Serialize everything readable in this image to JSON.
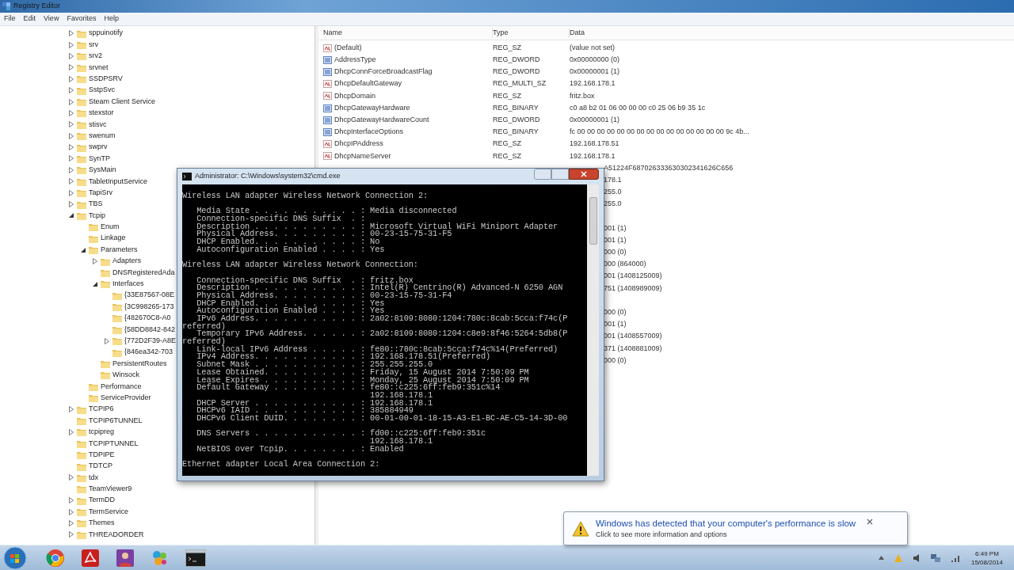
{
  "window": {
    "title": "Registry Editor"
  },
  "menu": [
    "File",
    "Edit",
    "View",
    "Favorites",
    "Help"
  ],
  "tree": [
    {
      "label": "sppuinotify",
      "expanded": false
    },
    {
      "label": "srv",
      "expanded": false
    },
    {
      "label": "srv2",
      "expanded": false
    },
    {
      "label": "srvnet",
      "expanded": false
    },
    {
      "label": "SSDPSRV",
      "expanded": false
    },
    {
      "label": "SstpSvc",
      "expanded": false
    },
    {
      "label": "Steam Client Service",
      "expanded": false
    },
    {
      "label": "stexstor",
      "expanded": false
    },
    {
      "label": "stisvc",
      "expanded": false
    },
    {
      "label": "swenum",
      "expanded": false
    },
    {
      "label": "swprv",
      "expanded": false
    },
    {
      "label": "SynTP",
      "expanded": false
    },
    {
      "label": "SysMain",
      "expanded": false
    },
    {
      "label": "TabletInputService",
      "expanded": false
    },
    {
      "label": "TapiSrv",
      "expanded": false
    },
    {
      "label": "TBS",
      "expanded": false
    },
    {
      "label": "Tcpip",
      "expanded": true,
      "children": [
        {
          "label": "Enum"
        },
        {
          "label": "Linkage"
        },
        {
          "label": "Parameters",
          "expanded": true,
          "children": [
            {
              "label": "Adapters",
              "expanded": false
            },
            {
              "label": "DNSRegisteredAda"
            },
            {
              "label": "Interfaces",
              "expanded": true,
              "children": [
                {
                  "label": "{33E87567-08E"
                },
                {
                  "label": "{3C998265-173"
                },
                {
                  "label": "{482670C8-A0"
                },
                {
                  "label": "{58DD8842-842"
                },
                {
                  "label": "{772D2F39-A8E",
                  "expanded": false
                },
                {
                  "label": "{846ea342-703"
                }
              ]
            },
            {
              "label": "PersistentRoutes"
            },
            {
              "label": "Winsock"
            }
          ]
        },
        {
          "label": "Performance"
        },
        {
          "label": "ServiceProvider"
        }
      ]
    },
    {
      "label": "TCPIP6",
      "expanded": false
    },
    {
      "label": "TCPIP6TUNNEL"
    },
    {
      "label": "tcpipreg",
      "expanded": false
    },
    {
      "label": "TCPIPTUNNEL"
    },
    {
      "label": "TDPIPE"
    },
    {
      "label": "TDTCP"
    },
    {
      "label": "tdx",
      "expanded": false
    },
    {
      "label": "TeamViewer9"
    },
    {
      "label": "TermDD",
      "expanded": false
    },
    {
      "label": "TermService",
      "expanded": false
    },
    {
      "label": "Themes",
      "expanded": false
    },
    {
      "label": "THREADORDER",
      "expanded": false
    }
  ],
  "values": {
    "columns": [
      "Name",
      "Type",
      "Data"
    ],
    "rows": [
      {
        "kind": "string",
        "name": "(Default)",
        "type": "REG_SZ",
        "data": "(value not set)"
      },
      {
        "kind": "number",
        "name": "AddressType",
        "type": "REG_DWORD",
        "data": "0x00000000 (0)"
      },
      {
        "kind": "number",
        "name": "DhcpConnForceBroadcastFlag",
        "type": "REG_DWORD",
        "data": "0x00000001 (1)"
      },
      {
        "kind": "string",
        "name": "DhcpDefaultGateway",
        "type": "REG_MULTI_SZ",
        "data": "192.168.178.1"
      },
      {
        "kind": "string",
        "name": "DhcpDomain",
        "type": "REG_SZ",
        "data": "fritz.box"
      },
      {
        "kind": "number",
        "name": "DhcpGatewayHardware",
        "type": "REG_BINARY",
        "data": "c0 a8 b2 01 06 00 00 00 c0 25 06 b9 35 1c"
      },
      {
        "kind": "number",
        "name": "DhcpGatewayHardwareCount",
        "type": "REG_DWORD",
        "data": "0x00000001 (1)"
      },
      {
        "kind": "number",
        "name": "DhcpInterfaceOptions",
        "type": "REG_BINARY",
        "data": "fc 00 00 00 00 00 00 00 00 00 00 00 00 00 00 00 9c 4b..."
      },
      {
        "kind": "string",
        "name": "DhcpIPAddress",
        "type": "REG_SZ",
        "data": "192.168.178.51"
      },
      {
        "kind": "string",
        "name": "DhcpNameServer",
        "type": "REG_SZ",
        "data": "192.168.178.1"
      },
      {
        "kind": "covered",
        "data": "A51224F687026333630302341626C656"
      },
      {
        "kind": "covered",
        "data": "178.1"
      },
      {
        "kind": "covered",
        "data": "255.0"
      },
      {
        "kind": "covered",
        "data": "255.0"
      },
      {
        "kind": "hidden"
      },
      {
        "kind": "covered",
        "data": "001 (1)"
      },
      {
        "kind": "covered",
        "data": "001 (1)"
      },
      {
        "kind": "covered",
        "data": "000 (0)"
      },
      {
        "kind": "covered",
        "data": "000 (864000)"
      },
      {
        "kind": "covered",
        "data": "001 (1408125009)"
      },
      {
        "kind": "covered",
        "data": "751 (1408989009)"
      },
      {
        "kind": "hidden"
      },
      {
        "kind": "covered",
        "data": "000 (0)"
      },
      {
        "kind": "covered",
        "data": "001 (1)"
      },
      {
        "kind": "covered",
        "data": "001 (1408557009)"
      },
      {
        "kind": "covered",
        "data": "371 (1408881009)"
      },
      {
        "kind": "covered",
        "data": "000 (0)"
      }
    ]
  },
  "console": {
    "title": "Administrator: C:\\Windows\\system32\\cmd.exe",
    "lines": [
      {
        "kind": "text",
        "text": "Wireless LAN adapter Wireless Network Connection 2:"
      },
      {
        "kind": "blank"
      },
      {
        "kind": "text",
        "text": "   Media State . . . . . . . . . . . : Media disconnected"
      },
      {
        "kind": "text",
        "text": "   Connection-specific DNS Suffix  . :"
      },
      {
        "kind": "text",
        "text": "   Description . . . . . . . . . . . : Microsoft Virtual WiFi Miniport Adapter"
      },
      {
        "kind": "text",
        "text": "   Physical Address. . . . . . . . . : 00-23-15-75-31-F5"
      },
      {
        "kind": "text",
        "text": "   DHCP Enabled. . . . . . . . . . . : No"
      },
      {
        "kind": "text",
        "text": "   Autoconfiguration Enabled . . . . : Yes"
      },
      {
        "kind": "blank"
      },
      {
        "kind": "text",
        "text": "Wireless LAN adapter Wireless Network Connection:"
      },
      {
        "kind": "blank"
      },
      {
        "kind": "text",
        "text": "   Connection-specific DNS Suffix  . : fritz.box"
      },
      {
        "kind": "text",
        "text": "   Description . . . . . . . . . . . : Intel(R) Centrino(R) Advanced-N 6250 AGN"
      },
      {
        "kind": "text",
        "text": "   Physical Address. . . . . . . . . : 00-23-15-75-31-F4"
      },
      {
        "kind": "text",
        "text": "   DHCP Enabled. . . . . . . . . . . : Yes"
      },
      {
        "kind": "text",
        "text": "   Autoconfiguration Enabled . . . . : Yes"
      },
      {
        "kind": "text",
        "text": "   IPv6 Address. . . . . . . . . . . : 2a02:8109:8080:1204:780c:8cab:5cca:f74c(P"
      },
      {
        "kind": "text",
        "text": "referred)"
      },
      {
        "kind": "text",
        "text": "   Temporary IPv6 Address. . . . . . : 2a02:8109:8080:1204:c8e9:8f46:5264:5db8(P"
      },
      {
        "kind": "text",
        "text": "referred)"
      },
      {
        "kind": "text",
        "text": "   Link-local IPv6 Address . . . . . : fe80::780c:8cab:5cca:f74c%14(Preferred)"
      },
      {
        "kind": "text",
        "text": "   IPv4 Address. . . . . . . . . . . : 192.168.178.51(Preferred)"
      },
      {
        "kind": "text",
        "text": "   Subnet Mask . . . . . . . . . . . : 255.255.255.0"
      },
      {
        "kind": "text",
        "text": "   Lease Obtained. . . . . . . . . . : Friday, 15 August 2014 7:50:09 PM"
      },
      {
        "kind": "text",
        "text": "   Lease Expires . . . . . . . . . . : Monday, 25 August 2014 7:50:09 PM"
      },
      {
        "kind": "text",
        "text": "   Default Gateway . . . . . . . . . : fe80::c225:6ff:feb9:351c%14"
      },
      {
        "kind": "text",
        "text": "                                       192.168.178.1"
      },
      {
        "kind": "text",
        "text": "   DHCP Server . . . . . . . . . . . : 192.168.178.1"
      },
      {
        "kind": "text",
        "text": "   DHCPv6 IAID . . . . . . . . . . . : 385884949"
      },
      {
        "kind": "text",
        "text": "   DHCPv6 Client DUID. . . . . . . . : 00-01-00-01-18-15-A3-E1-BC-AE-C5-14-3D-00"
      },
      {
        "kind": "blank"
      },
      {
        "kind": "text",
        "text": "   DNS Servers . . . . . . . . . . . : fd00::c225:6ff:feb9:351c"
      },
      {
        "kind": "text",
        "text": "                                       192.168.178.1"
      },
      {
        "kind": "text",
        "text": "   NetBIOS over Tcpip. . . . . . . . : Enabled"
      },
      {
        "kind": "blank"
      },
      {
        "kind": "text",
        "text": "Ethernet adapter Local Area Connection 2:"
      }
    ]
  },
  "notification": {
    "title": "Windows has detected that your computer's performance is slow",
    "subtitle": "Click to see more information and options"
  },
  "taskbar": {
    "apps": [
      {
        "kind": "browser"
      },
      {
        "kind": "pdf"
      },
      {
        "kind": "person"
      },
      {
        "kind": "paint"
      },
      {
        "kind": "console"
      }
    ],
    "time": "6:49 PM",
    "date": "15/08/2014"
  }
}
